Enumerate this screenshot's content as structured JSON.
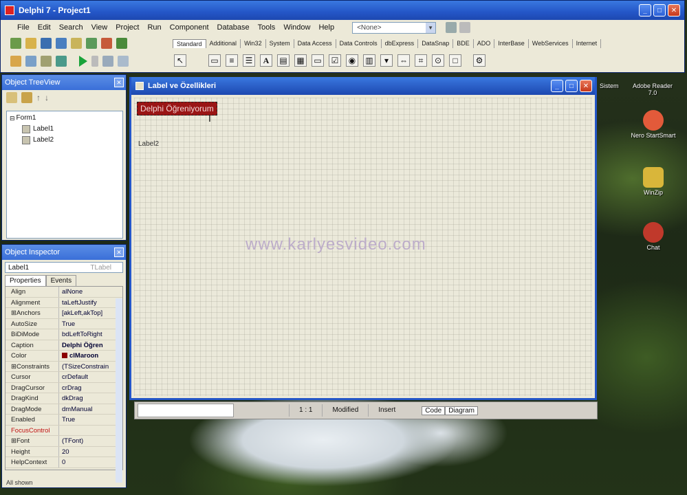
{
  "ide": {
    "title": "Delphi 7 - Project1",
    "menu": [
      "File",
      "Edit",
      "Search",
      "View",
      "Project",
      "Run",
      "Component",
      "Database",
      "Tools",
      "Window",
      "Help"
    ],
    "desktop_combo": "<None>",
    "palette_tabs": [
      "Standard",
      "Additional",
      "Win32",
      "System",
      "Data Access",
      "Data Controls",
      "dbExpress",
      "DataSnap",
      "BDE",
      "ADO",
      "InterBase",
      "WebServices",
      "Internet"
    ]
  },
  "tree": {
    "title": "Object TreeView",
    "nodes": [
      "Form1",
      "Label1",
      "Label2"
    ]
  },
  "inspector": {
    "title": "Object Inspector",
    "selected_object": "Label1",
    "selected_type": "TLabel",
    "tabs": [
      "Properties",
      "Events"
    ],
    "rows": [
      {
        "name": "Align",
        "value": "alNone"
      },
      {
        "name": "Alignment",
        "value": "taLeftJustify"
      },
      {
        "name": "⊞Anchors",
        "value": "[akLeft,akTop]"
      },
      {
        "name": "AutoSize",
        "value": "True"
      },
      {
        "name": "BiDiMode",
        "value": "bdLeftToRight"
      },
      {
        "name": "Caption",
        "value": "Delphi Öğren"
      },
      {
        "name": "Color",
        "value": "clMaroon"
      },
      {
        "name": "⊞Constraints",
        "value": "(TSizeConstrain"
      },
      {
        "name": "Cursor",
        "value": "crDefault"
      },
      {
        "name": "DragCursor",
        "value": "crDrag"
      },
      {
        "name": "DragKind",
        "value": "dkDrag"
      },
      {
        "name": "DragMode",
        "value": "dmManual"
      },
      {
        "name": "Enabled",
        "value": "True"
      },
      {
        "name": "FocusControl",
        "value": ""
      },
      {
        "name": "⊞Font",
        "value": "(TFont)"
      },
      {
        "name": "Height",
        "value": "20"
      },
      {
        "name": "HelpContext",
        "value": "0"
      }
    ],
    "status": "All shown"
  },
  "form": {
    "title": "Label ve Özellikleri",
    "label1_caption": "Delphi Öğreniyorum",
    "label2_caption": "Label2",
    "watermark": "www.karlyesvideo.com"
  },
  "editor_status": {
    "position": "1 : 1",
    "modified": "Modified",
    "insert": "Insert",
    "tab_code": "Code",
    "tab_diagram": "Diagram"
  },
  "desktop_icons": [
    {
      "label": "Nero StartSmart",
      "color": "#e25a3a"
    },
    {
      "label": "WinZip",
      "color": "#d9b63a"
    },
    {
      "label": "Chat",
      "color": "#c0392b"
    }
  ],
  "desktop_top_labels": [
    "Sistem",
    "Adobe Reader 7.0"
  ]
}
